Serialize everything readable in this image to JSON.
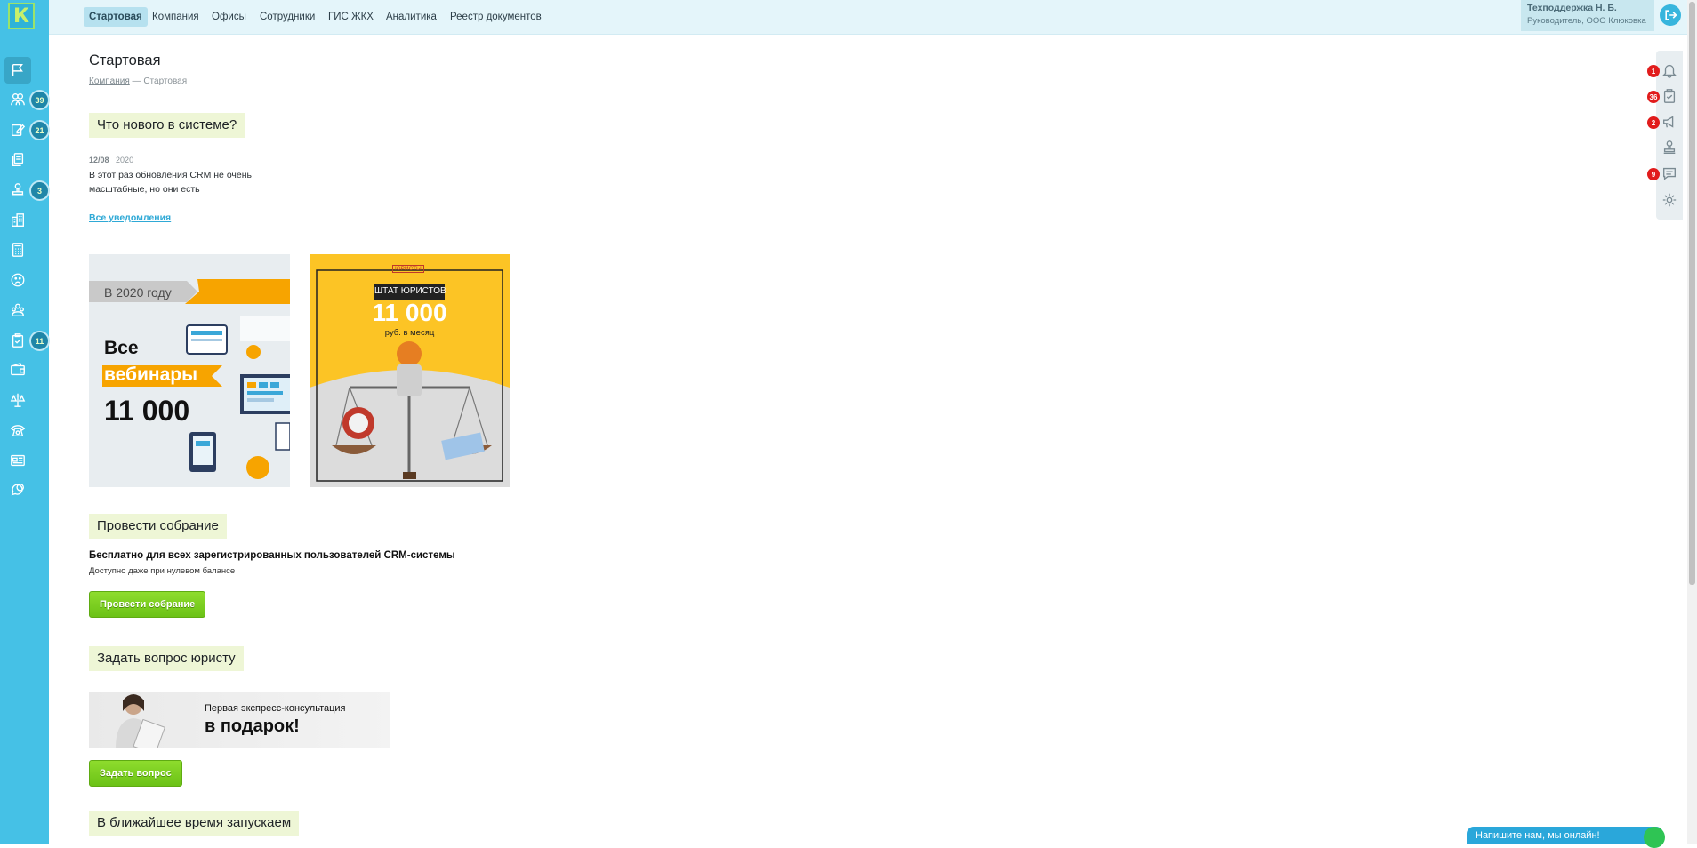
{
  "logo": {
    "letter": "К"
  },
  "topnav": {
    "items": [
      "Стартовая",
      "Компания",
      "Офисы",
      "Сотрудники",
      "ГИС ЖКХ",
      "Аналитика",
      "Реестр документов"
    ]
  },
  "user": {
    "name": "Техподдержка Н. Б.",
    "role": "Руководитель, ООО Клюковка"
  },
  "sidebar": {
    "badges": [
      "39",
      "21",
      "3",
      "11"
    ],
    "icons": [
      "flag-icon",
      "people-icon",
      "edit-icon",
      "documents-icon",
      "stamp-icon",
      "building-icon",
      "calculator-icon",
      "smiley-icon",
      "group-icon",
      "clipboard-icon",
      "wallet-icon",
      "scales-icon",
      "phone-icon",
      "card-icon",
      "chat-icon"
    ]
  },
  "page": {
    "title": "Стартовая",
    "breadcrumb_link": "Компания",
    "breadcrumb_sep": "—",
    "breadcrumb_current": "Стартовая"
  },
  "news": {
    "heading": "Что нового в системе?",
    "date_day": "12/08",
    "date_year": "2020",
    "text": "В этот раз обновления CRM не очень масштабные, но они есть",
    "all_link": "Все уведомления"
  },
  "banners": {
    "webinar": {
      "year_text": "В 2020 году",
      "line1": "Все",
      "line2": "вебинары",
      "price": "11 000"
    },
    "lawyers": {
      "brand": "ЮРИСТЫ",
      "title": "ШТАТ ЮРИСТОВ",
      "price": "11 000",
      "per": "руб. в месяц"
    }
  },
  "meeting": {
    "heading": "Провести собрание",
    "bold": "Бесплатно для всех зарегистрированных пользователей CRM-системы",
    "small": "Доступно даже при нулевом балансе",
    "button": "Провести собрание"
  },
  "lawyer_question": {
    "heading": "Задать вопрос юристу",
    "banner_line1": "Первая экспресс-консультация",
    "banner_line2": "в подарок!",
    "button": "Задать вопрос"
  },
  "soon": {
    "heading": "В ближайшее время запускаем"
  },
  "right_panel": {
    "icons": [
      "bell-icon",
      "clipboard-check-icon",
      "megaphone-icon",
      "stamp-icon",
      "message-icon",
      "settings-icon"
    ],
    "badges": [
      "1",
      "36",
      "2",
      "9"
    ]
  },
  "chat": {
    "label": "Напишите нам, мы онлайн!"
  },
  "colors": {
    "sidebar": "#45c1e6",
    "topbar": "#e4f5fa",
    "accent_green": "#7ccf22",
    "badge_red": "#e11c1c",
    "link_blue": "#2fa9d6"
  }
}
